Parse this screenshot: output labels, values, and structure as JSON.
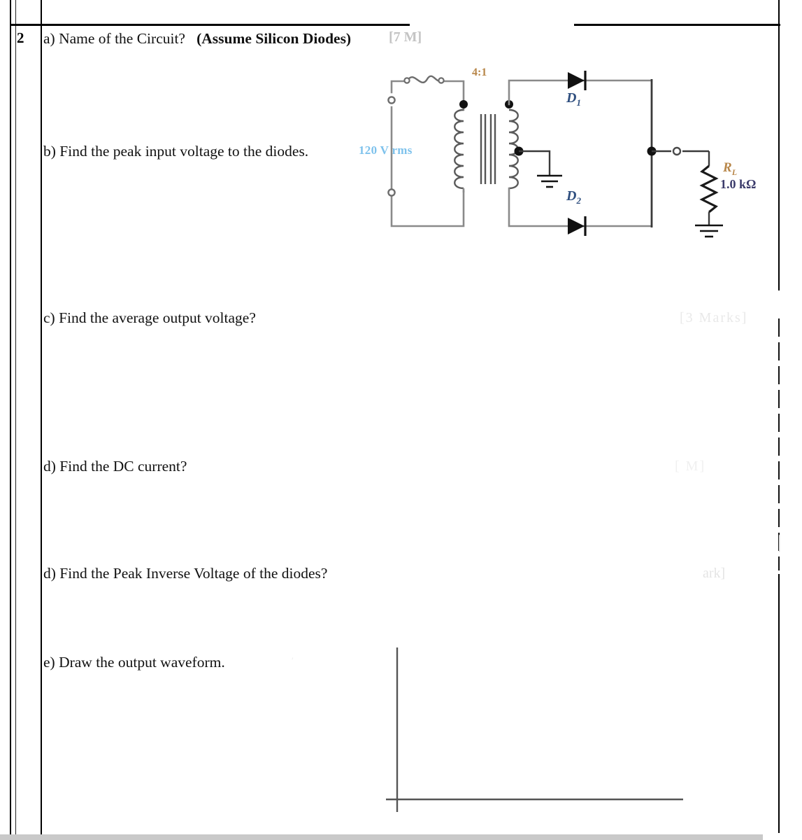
{
  "document": {
    "type": "exam-question-sheet",
    "question_number": "2",
    "smudge_after_heading": "[7 M]"
  },
  "questions": [
    {
      "id": "a",
      "prefix": "a)",
      "text": "Name of the Circuit?",
      "bold_suffix": "(Assume Silicon Diodes)"
    },
    {
      "id": "b",
      "prefix": "b)",
      "text": "Find the peak input voltage to the diodes."
    },
    {
      "id": "c",
      "prefix": "c)",
      "text": "Find the average output voltage?"
    },
    {
      "id": "d1",
      "prefix": "d)",
      "text": "Find the DC current?"
    },
    {
      "id": "d2",
      "prefix": "d)",
      "text": "Find the Peak Inverse Voltage of the diodes?"
    },
    {
      "id": "e",
      "prefix": "e)",
      "text": "Draw the output waveform."
    }
  ],
  "circuit": {
    "title": "center-tapped full-wave rectifier",
    "source_label": "120 V rms",
    "source_color": "#7ec2ec",
    "turns_ratio": "4:1",
    "turns_ratio_color": "#b8874a",
    "diode1_label": "D",
    "diode1_sub": "1",
    "diode2_label": "D",
    "diode2_sub": "2",
    "diode_label_color": "#2f4f7f",
    "load_label": "R",
    "load_sub": "L",
    "load_value": "1.0 kΩ",
    "load_label_color": "#b8874a",
    "load_value_color": "#3b3b6b",
    "wire_color": "#8a8a8a",
    "dark_wire_color": "#3a3a3a"
  },
  "waveform_area": {
    "hint": "empty axes for student drawing",
    "axis_color": "#555555"
  },
  "ghost_marks": {
    "mid_right": "[3 Marks]",
    "lower_right": "ark]",
    "dc_right": "[ M]",
    "waveform_right": "|"
  }
}
